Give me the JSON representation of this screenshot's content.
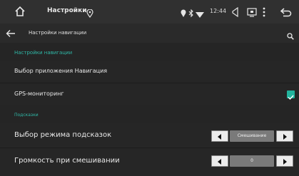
{
  "status_bar": {
    "title": "Настройки",
    "time": "12:44"
  },
  "app_bar": {
    "title": "Настройки навигации"
  },
  "sections": [
    {
      "header": "Настройки навигации"
    },
    {
      "header": "Подсказки"
    }
  ],
  "rows": {
    "nav_app": {
      "label": "Выбор приложения Навигация"
    },
    "gps": {
      "label": "GPS-мониторинг",
      "checked": true
    },
    "hint_mode": {
      "label": "Выбор режима подсказок",
      "value": "Смешивание"
    },
    "mix_volume": {
      "label": "Громкость при смешивании",
      "value": "0"
    }
  },
  "colors": {
    "accent": "#2fb8a7",
    "checkbox": "#22b39d"
  },
  "icons": {
    "home": "home-icon",
    "location": "location-icon",
    "status": [
      "location-icon",
      "bluetooth-icon",
      "wifi-icon"
    ],
    "volume": "volume-icon",
    "screen": "screen-icon",
    "menu": "more-vert-icon",
    "back": "return-icon",
    "nav_back": "arrow-left-icon",
    "search": "search-icon"
  }
}
